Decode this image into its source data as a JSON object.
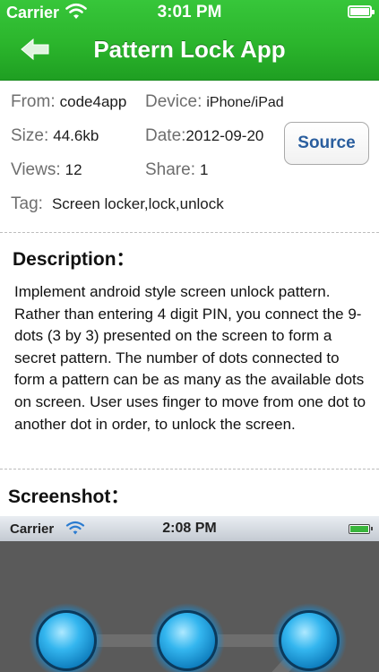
{
  "status_bar": {
    "carrier": "Carrier",
    "time": "3:01 PM"
  },
  "nav": {
    "title": "Pattern Lock App",
    "back_icon": "back-arrow-icon"
  },
  "info": {
    "from_label": "From:",
    "from_value": "code4app",
    "device_label": "Device:",
    "device_value": "iPhone/iPad",
    "size_label": "Size:",
    "size_value": "44.6kb",
    "date_label": "Date:",
    "date_value": "2012-09-20",
    "views_label": "Views:",
    "views_value": "12",
    "share_label": "Share:",
    "share_value": "1",
    "tag_label": "Tag:",
    "tag_value": "Screen locker,lock,unlock",
    "source_button": "Source"
  },
  "description": {
    "heading": "Description：",
    "text": "Implement android style screen unlock pattern. Rather than entering 4 digit PIN, you connect the 9-dots (3 by 3) presented on the screen to form a secret pattern. The number of dots connected to form a pattern can be as many as the available dots on screen. User uses finger to move from one dot to another dot in order, to unlock the screen."
  },
  "screenshot": {
    "heading": "Screenshot：",
    "preview": {
      "carrier": "Carrier",
      "time": "2:08 PM"
    }
  },
  "colors": {
    "header_green": "#2bb52c",
    "source_text": "#2a5e9e",
    "dot_blue": "#2aa6e6",
    "preview_bg": "#5a5a5a"
  }
}
